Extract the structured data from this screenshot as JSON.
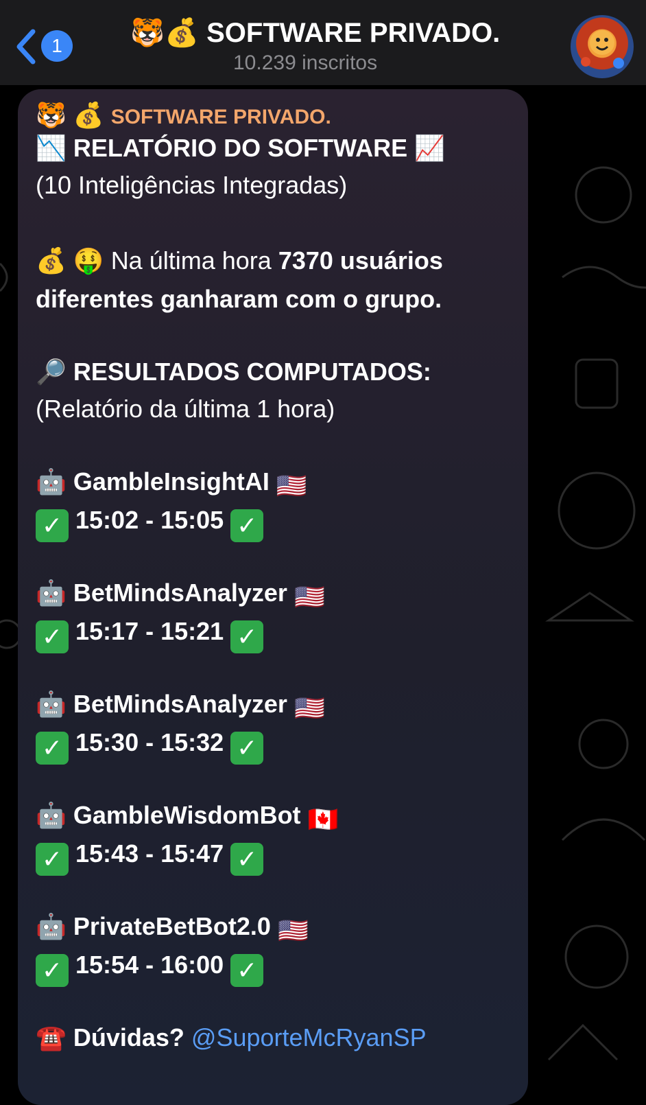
{
  "header": {
    "back_badge_count": "1",
    "title_emoji_1": "🐯",
    "title_emoji_2": "💰",
    "title": "SOFTWARE PRIVADO.",
    "subtitle": "10.239 inscritos"
  },
  "message": {
    "sender_emoji_1": "🐯",
    "sender_emoji_2": "💰",
    "sender_name": "SOFTWARE PRIVADO.",
    "report_icon_left": "📉",
    "report_title": "RELATÓRIO DO SOFTWARE",
    "report_icon_right": "📈",
    "report_subtitle": "(10 Inteligências Integradas)",
    "users_emoji_1": "💰",
    "users_emoji_2": "🤑",
    "users_prefix": "Na última hora",
    "users_count_text": "7370 usuários",
    "users_suffix": "diferentes ganharam com o grupo.",
    "results_icon": "🔎",
    "results_title": "RESULTADOS COMPUTADOS:",
    "results_subtitle": "(Relatório da última 1 hora)",
    "results": [
      {
        "bot_icon": "🤖",
        "bot": "GambleInsightAI",
        "flag": "🇺🇸",
        "check": "✓",
        "time": "15:02 - 15:05"
      },
      {
        "bot_icon": "🤖",
        "bot": "BetMindsAnalyzer",
        "flag": "🇺🇸",
        "check": "✓",
        "time": "15:17 - 15:21"
      },
      {
        "bot_icon": "🤖",
        "bot": "BetMindsAnalyzer",
        "flag": "🇺🇸",
        "check": "✓",
        "time": "15:30 - 15:32"
      },
      {
        "bot_icon": "🤖",
        "bot": "GambleWisdomBot",
        "flag": "🇨🇦",
        "check": "✓",
        "time": "15:43 - 15:47"
      },
      {
        "bot_icon": "🤖",
        "bot": "PrivateBetBot2.0",
        "flag": "🇺🇸",
        "check": "✓",
        "time": "15:54 - 16:00"
      }
    ],
    "support_icon": "☎️",
    "support_label": "Dúvidas?",
    "support_handle": "@SuporteMcRyanSP"
  },
  "colors": {
    "accent_blue": "#3a86f7",
    "sender_orange": "#f3a66b",
    "link_blue": "#5a9df5",
    "check_green": "#2fa84a"
  }
}
